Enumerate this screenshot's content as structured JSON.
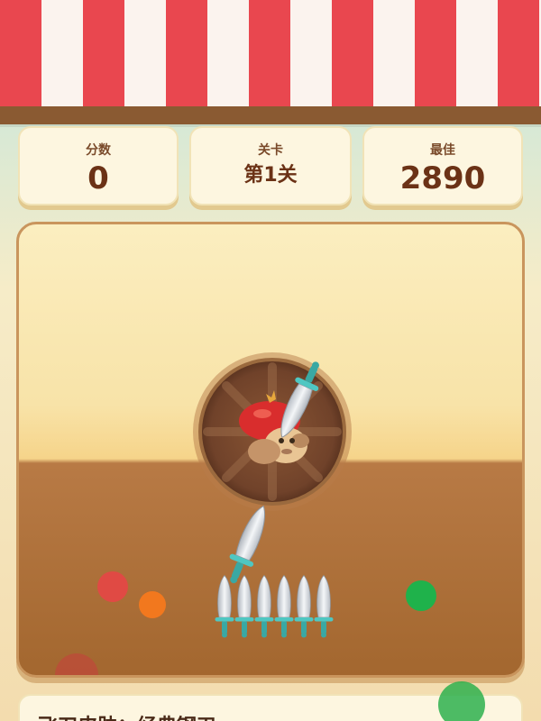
{
  "stats": {
    "score_label": "分数",
    "score_value": "0",
    "level_label": "关卡",
    "level_value": "第1关",
    "best_label": "最佳",
    "best_value": "2890"
  },
  "skin_info": "飞刀皮肤：经典钢刃",
  "game": {
    "knives_remaining": 6,
    "stuck_knives": 1,
    "colors": {
      "awning_red": "#e9474f",
      "awning_white": "#fbf3ee",
      "wood": "#8a5a32",
      "card": "#fdf6e0",
      "text": "#6b3216",
      "knife_handle": "#4fc7c2",
      "blade": "#d9dde3"
    }
  }
}
